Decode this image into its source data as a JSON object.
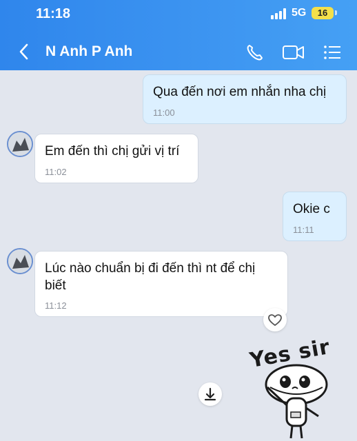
{
  "status_bar": {
    "time": "11:18",
    "network": "5G",
    "battery": "16"
  },
  "header": {
    "contact_name": "N Anh P Anh"
  },
  "messages": [
    {
      "direction": "outgoing",
      "text": "Qua đến nơi em nhắn nha chị",
      "time": "11:00"
    },
    {
      "direction": "incoming",
      "text": "Em đến thì chị gửi vị trí",
      "time": "11:02"
    },
    {
      "direction": "outgoing",
      "text": "Okie c",
      "time": "11:11"
    },
    {
      "direction": "incoming",
      "text_line1": "Lúc nào chuẩn bị đi đến thì nt để chị",
      "text_line2": "biết",
      "time": "11:12"
    }
  ],
  "sticker": {
    "text": "Yes sir"
  },
  "icons": {
    "back": "chevron-left-icon",
    "call": "phone-icon",
    "video": "video-camera-icon",
    "menu": "list-menu-icon",
    "react": "heart-icon",
    "download": "download-arrow-icon"
  },
  "colors": {
    "header": "#3d95f1",
    "outgoing_bubble": "#dcf0ff",
    "background": "#e2e6ee",
    "battery": "#f4e04a"
  }
}
